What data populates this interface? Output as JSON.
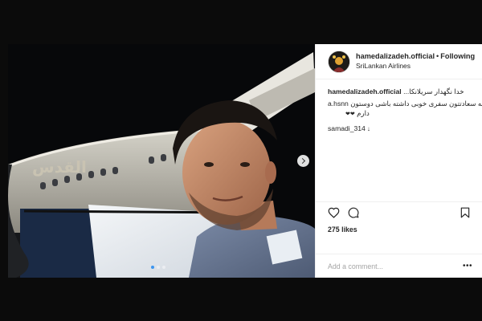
{
  "post": {
    "username": "hamedalizadeh.official",
    "separator": "•",
    "follow_label": "Following",
    "location": "SriLankan Airlines",
    "caption": {
      "author": "hamedalizadeh.official",
      "text": "خدا نگهدار سریلانکا...",
      "line2_text": "خوشا به سعادتتون سفری خوبی داشته باشی دوستون",
      "line2_user": "a.hsnn",
      "line3_text": "دارم",
      "line3_emoji": "❤❤",
      "reply_user": "samadi_314",
      "reply_arrow": "↓"
    },
    "likes": "275 likes",
    "comment_placeholder": "Add a comment...",
    "more_label": "•••"
  },
  "media": {
    "aircraft_lettering": "القدس",
    "slide_count": 3,
    "active_slide": 1
  },
  "icons": {
    "like": "heart-icon",
    "comment": "comment-icon",
    "save": "bookmark-icon",
    "next": "chevron-right-icon"
  },
  "colors": {
    "accent": "#3d95ef",
    "text": "#262626",
    "muted": "#a5a5a5",
    "border": "#efefef",
    "backdrop": "#0b0b0b"
  }
}
